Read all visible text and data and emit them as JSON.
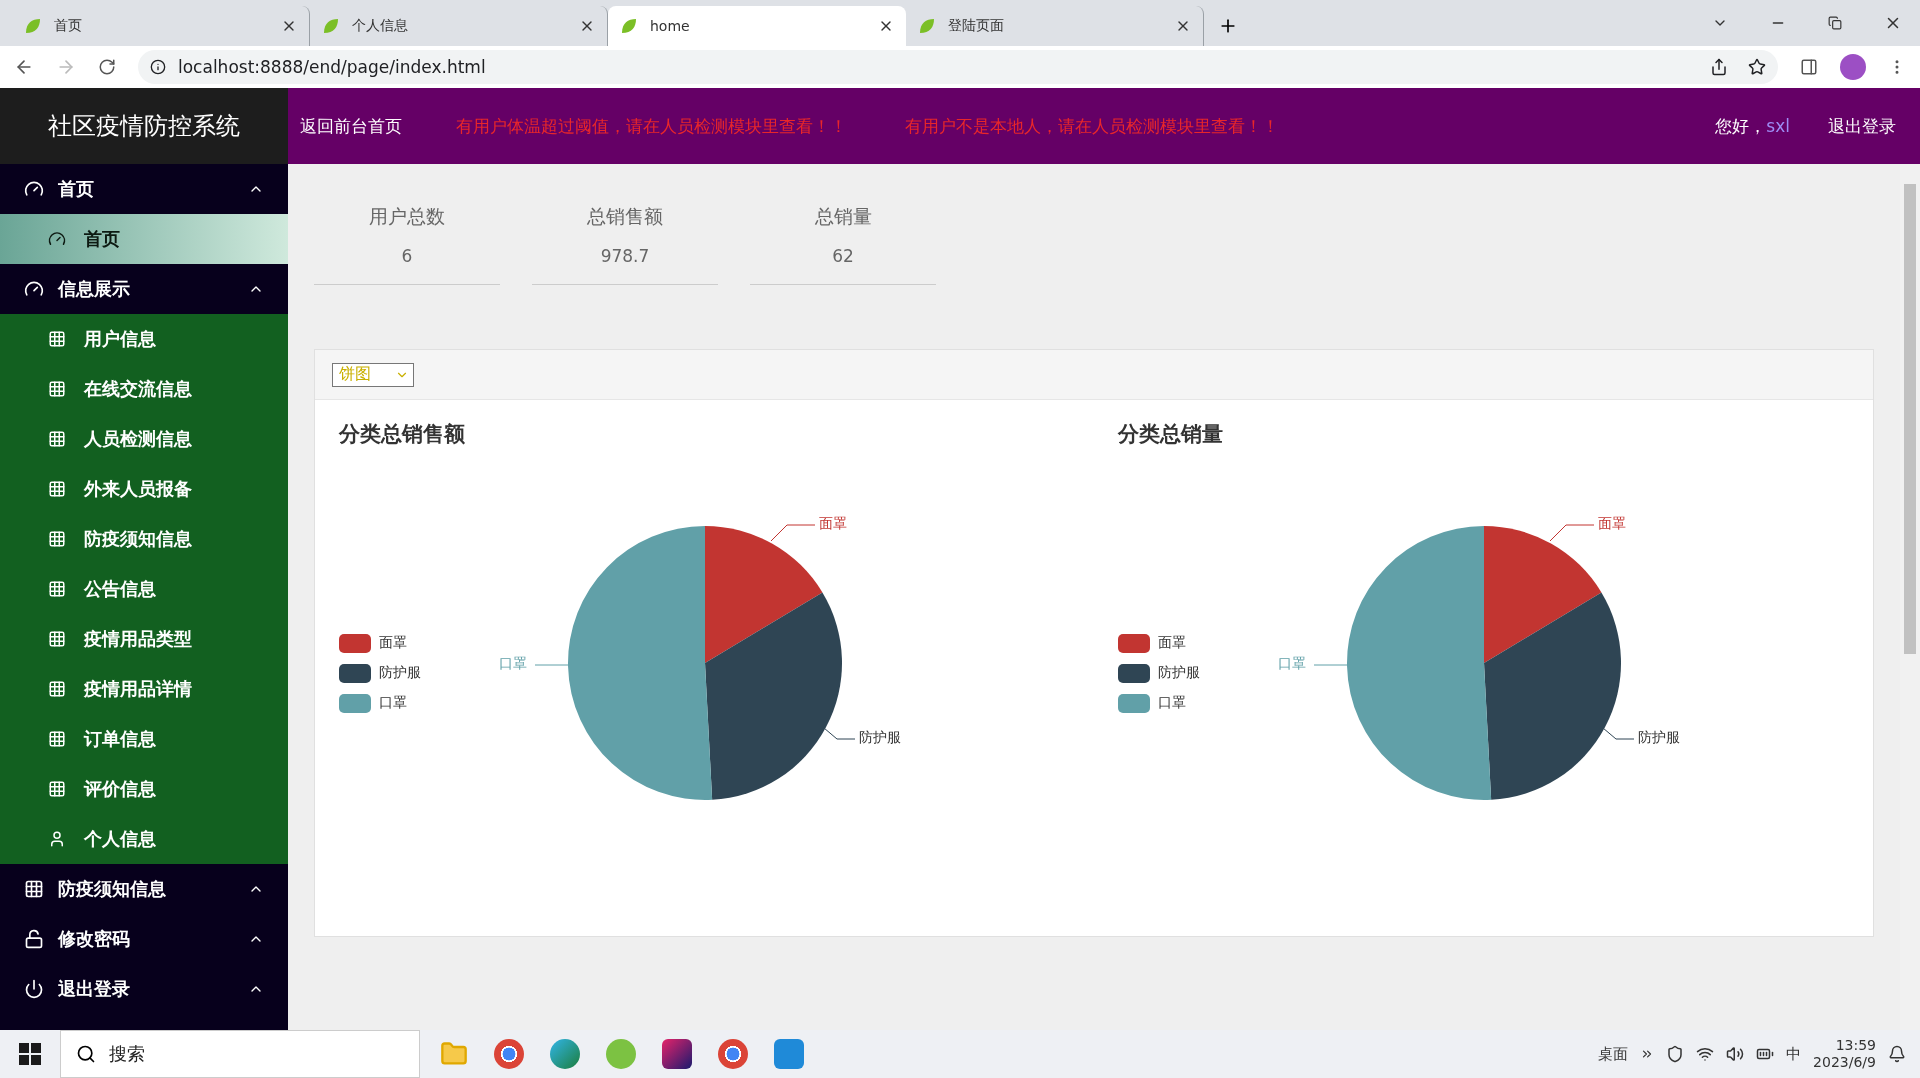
{
  "browser": {
    "tabs": [
      {
        "title": "首页",
        "selected": false
      },
      {
        "title": "个人信息",
        "selected": false
      },
      {
        "title": "home",
        "selected": true
      },
      {
        "title": "登陆页面",
        "selected": false
      }
    ],
    "url": "localhost:8888/end/page/index.html"
  },
  "header": {
    "title": "社区疫情防控系统",
    "home_link": "返回前台首页",
    "alerts": [
      "有用户体温超过阈值，请在人员检测模块里查看！！",
      "有用户不是本地人，请在人员检测模块里查看！！"
    ],
    "greeting": "您好，",
    "user": "sxl",
    "logout": "退出登录"
  },
  "sidebar": {
    "groups": [
      {
        "label": "首页",
        "children": [
          {
            "label": "首页",
            "kind": "dashboard",
            "selected": true
          }
        ]
      },
      {
        "label": "信息展示",
        "children": [
          {
            "label": "用户信息",
            "kind": "table",
            "selected": false
          },
          {
            "label": "在线交流信息",
            "kind": "table",
            "selected": false
          },
          {
            "label": "人员检测信息",
            "kind": "table",
            "selected": false
          },
          {
            "label": "外来人员报备",
            "kind": "table",
            "selected": false
          },
          {
            "label": "防疫须知信息",
            "kind": "table",
            "selected": false
          },
          {
            "label": "公告信息",
            "kind": "table",
            "selected": false
          },
          {
            "label": "疫情用品类型",
            "kind": "table",
            "selected": false
          },
          {
            "label": "疫情用品详情",
            "kind": "table",
            "selected": false
          },
          {
            "label": "订单信息",
            "kind": "table",
            "selected": false
          },
          {
            "label": "评价信息",
            "kind": "table",
            "selected": false
          },
          {
            "label": "个人信息",
            "kind": "person",
            "selected": false
          }
        ]
      },
      {
        "label": "防疫须知信息"
      },
      {
        "label": "修改密码"
      },
      {
        "label": "退出登录"
      }
    ]
  },
  "stats": [
    {
      "label": "用户总数",
      "value": "6"
    },
    {
      "label": "总销售额",
      "value": "978.7"
    },
    {
      "label": "总销量",
      "value": "62"
    }
  ],
  "chart_panel": {
    "select": "饼图",
    "charts": [
      {
        "title": "分类总销售额",
        "legend": [
          {
            "name": "面罩",
            "color": "#c23531"
          },
          {
            "name": "防护服",
            "color": "#2f4554"
          },
          {
            "name": "口罩",
            "color": "#61a0a8"
          }
        ],
        "slice_labels": [
          "面罩",
          "防护服",
          "口罩"
        ]
      },
      {
        "title": "分类总销量",
        "legend": [
          {
            "name": "面罩",
            "color": "#c23531"
          },
          {
            "name": "防护服",
            "color": "#2f4554"
          },
          {
            "name": "口罩",
            "color": "#61a0a8"
          }
        ],
        "slice_labels": [
          "面罩",
          "防护服",
          "口罩"
        ]
      }
    ]
  },
  "taskbar": {
    "search_placeholder": "搜索",
    "desktop": "桌面",
    "ime": "中",
    "time": "13:59",
    "date": "2023/6/9"
  }
}
